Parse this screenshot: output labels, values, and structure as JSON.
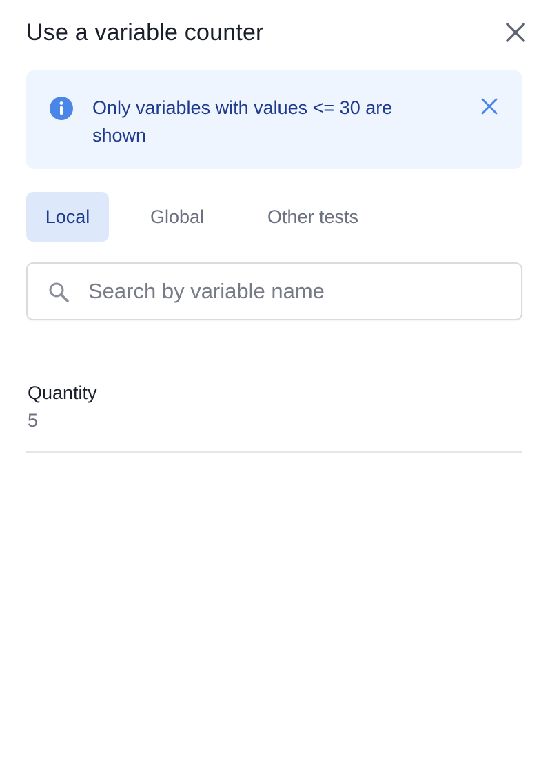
{
  "header": {
    "title": "Use a variable counter",
    "close_icon": "close-icon"
  },
  "banner": {
    "text": "Only variables with values <= 30 are shown",
    "info_icon": "info-icon",
    "close_icon": "close-icon",
    "background": "#eff5fe",
    "text_color": "#1f3b8f",
    "icon_color": "#4a86e8"
  },
  "tabs": [
    {
      "label": "Local",
      "active": true
    },
    {
      "label": "Global",
      "active": false
    },
    {
      "label": "Other tests",
      "active": false
    }
  ],
  "search": {
    "placeholder": "Search by variable name",
    "value": "",
    "icon": "search-icon"
  },
  "variables": [
    {
      "name": "Quantity",
      "value": "5"
    }
  ]
}
